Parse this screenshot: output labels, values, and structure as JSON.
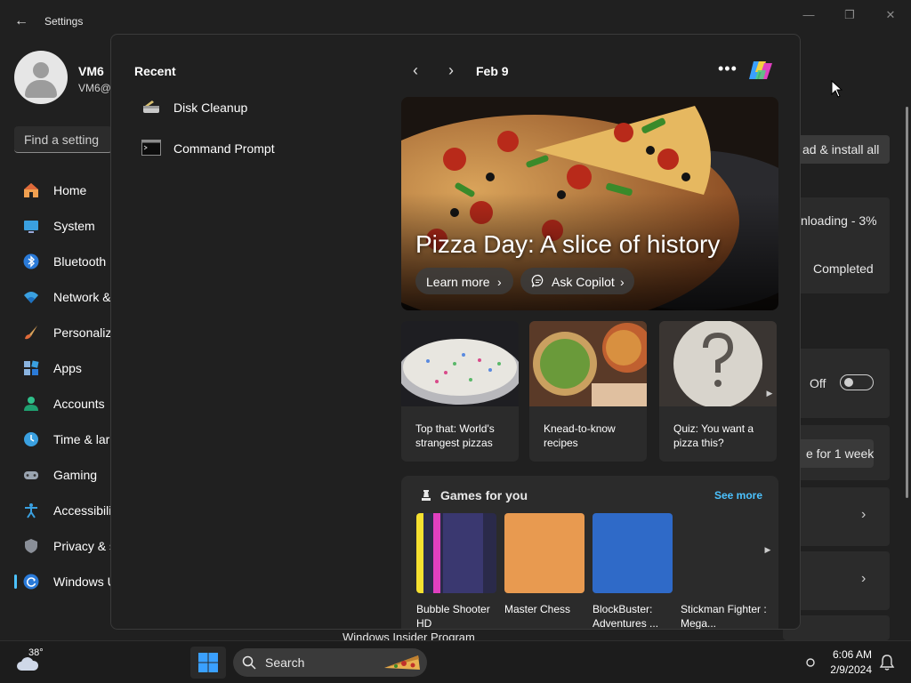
{
  "settings": {
    "title": "Settings",
    "user": {
      "name": "VM6",
      "email": "VM6@"
    },
    "search_placeholder": "Find a setting",
    "nav": [
      {
        "label": "Home",
        "icon": "home-icon"
      },
      {
        "label": "System",
        "icon": "monitor-icon"
      },
      {
        "label": "Bluetooth",
        "icon": "bluetooth-icon"
      },
      {
        "label": "Network &",
        "icon": "wifi-icon"
      },
      {
        "label": "Personaliz",
        "icon": "brush-icon"
      },
      {
        "label": "Apps",
        "icon": "apps-icon"
      },
      {
        "label": "Accounts",
        "icon": "person-icon"
      },
      {
        "label": "Time & lar",
        "icon": "clock-icon"
      },
      {
        "label": "Gaming",
        "icon": "gamepad-icon"
      },
      {
        "label": "Accessibili",
        "icon": "accessibility-icon"
      },
      {
        "label": "Privacy & s",
        "icon": "shield-icon"
      },
      {
        "label": "Windows U",
        "icon": "update-icon"
      }
    ],
    "right": {
      "install_button": "ad & install all",
      "downloading": "nloading - 3%",
      "completed": "Completed",
      "toggle_label": "Off",
      "pause_button": "e for 1 week",
      "insider_program": "Windows Insider Program"
    }
  },
  "widgets": {
    "recent_title": "Recent",
    "recent_items": [
      {
        "label": "Disk Cleanup",
        "icon": "disk-cleanup-icon"
      },
      {
        "label": "Command Prompt",
        "icon": "command-prompt-icon"
      }
    ],
    "date": "Feb 9",
    "hero": {
      "title": "Pizza Day: A slice of history",
      "learn_more": "Learn more",
      "ask_copilot": "Ask Copilot"
    },
    "cards": [
      {
        "caption": "Top that: World's strangest pizzas"
      },
      {
        "caption": "Knead-to-know recipes"
      },
      {
        "caption": "Quiz: You want a pizza this?"
      }
    ],
    "games": {
      "title": "Games for you",
      "see_more": "See more",
      "items": [
        {
          "name": "Bubble Shooter HD"
        },
        {
          "name": "Master Chess"
        },
        {
          "name": "BlockBuster: Adventures ..."
        },
        {
          "name": "Stickman Fighter : Mega..."
        }
      ]
    }
  },
  "taskbar": {
    "temperature": "38°",
    "search_label": "Search",
    "time": "6:06 AM",
    "date": "2/9/2024"
  },
  "colors": {
    "accent": "#4cc2ff",
    "background": "#202020",
    "card": "#2b2b2b"
  }
}
